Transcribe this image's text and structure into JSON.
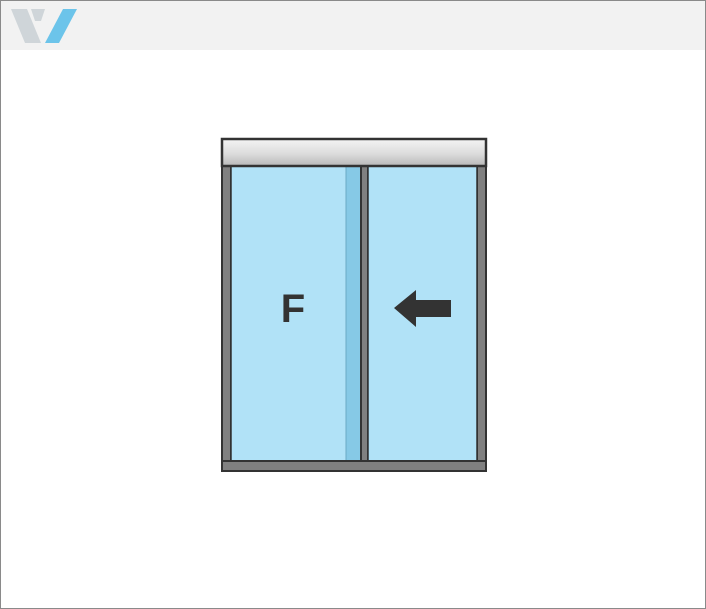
{
  "header": {
    "logo_icon": "brand-w-logo"
  },
  "diagram": {
    "left_panel": {
      "label": "F"
    },
    "right_panel": {
      "icon": "arrow-left-icon"
    },
    "colors": {
      "glass": "#b1e2f7",
      "glass_strip": "#86c9e6",
      "frame": "#808080",
      "outline": "#333333",
      "header_band": "#f2f2f2",
      "logo_light": "#cfd5d9",
      "logo_blue": "#6cc4ea"
    }
  }
}
